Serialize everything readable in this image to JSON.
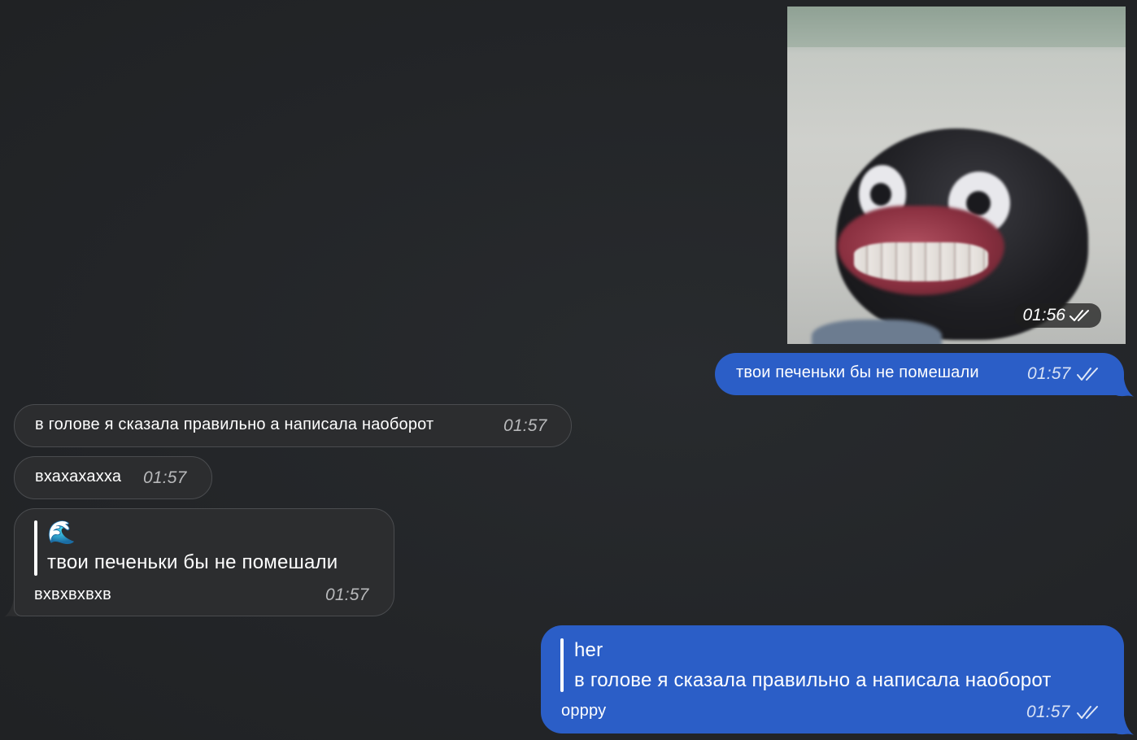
{
  "image_message": {
    "time": "01:56",
    "status_icon": "double-check-icon"
  },
  "messages": [
    {
      "direction": "outgoing",
      "text": "твои печеньки бы не помешали",
      "time": "01:57",
      "status_icon": "double-check-icon"
    },
    {
      "direction": "incoming",
      "text": "в голове я сказала правильно а написала наоборот",
      "time": "01:57"
    },
    {
      "direction": "incoming",
      "text": "вхахахахха",
      "time": "01:57"
    },
    {
      "direction": "incoming",
      "reply_emoji": "🌊",
      "reply_text": "твои печеньки бы не помешали",
      "text": "вхвхвхвхв",
      "time": "01:57"
    },
    {
      "direction": "outgoing",
      "reply_author": "her",
      "reply_text": "в голове я сказала правильно а написала наоборот",
      "text": "оррру",
      "time": "01:57",
      "status_icon": "double-check-icon"
    }
  ],
  "colors": {
    "background": "#232629",
    "outgoing_bubble": "#2b5ec7",
    "incoming_bubble": "#2c2d2f"
  }
}
